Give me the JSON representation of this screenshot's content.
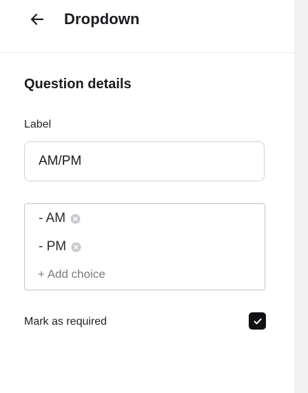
{
  "header": {
    "title": "Dropdown",
    "back_icon": "arrow-left-icon"
  },
  "section": {
    "title": "Question details"
  },
  "label_field": {
    "label": "Label",
    "value": "AM/PM"
  },
  "choices": {
    "items": [
      {
        "label": "- AM",
        "remove_icon": "remove-circle-icon"
      },
      {
        "label": "- PM",
        "remove_icon": "remove-circle-icon"
      }
    ],
    "add_label": "+ Add choice"
  },
  "required": {
    "label": "Mark as required",
    "checked": true,
    "checkbox_color": "#111114"
  },
  "colors": {
    "background": "#ffffff",
    "sidebar_strip": "#f1f1f2",
    "text": "#1b1b1f",
    "muted_text": "#7a7a80",
    "border": "#d2d2d6"
  }
}
